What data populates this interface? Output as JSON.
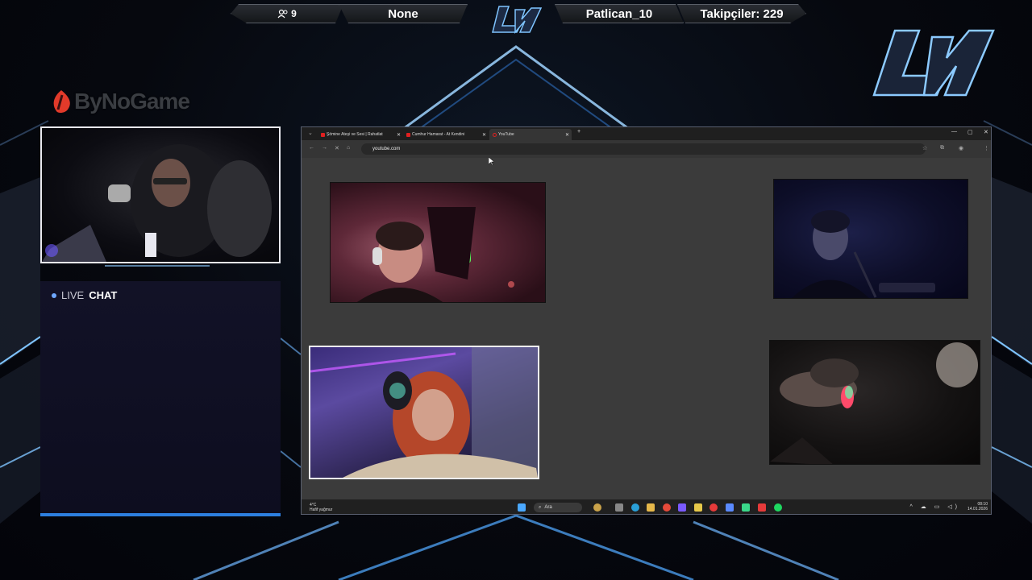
{
  "topbar": {
    "viewers": "9",
    "game": "None",
    "streamer": "Patlican_10",
    "followers": "Takipçiler: 229"
  },
  "sponsor": {
    "name": "ByNoGame"
  },
  "chat": {
    "live": "LIVE",
    "word": "CHAT"
  },
  "browser": {
    "tabs": [
      {
        "title": "Şömine Ateşi ve Sesi | Rahatlat"
      },
      {
        "title": "Cumhur Hamarat - At Kendini"
      },
      {
        "title": "YouTube"
      }
    ],
    "new_tab": "+",
    "url": "youtube.com"
  },
  "taskbar": {
    "weather_temp": "4°C",
    "weather_desc": "Hafif yağmur",
    "search_placeholder": "Ara",
    "time": "08:10",
    "date": "14.01.2026"
  },
  "colors": {
    "accent": "#2d7fe0",
    "brand_red": "#e23a2a",
    "frame": "#e8e8ee"
  }
}
